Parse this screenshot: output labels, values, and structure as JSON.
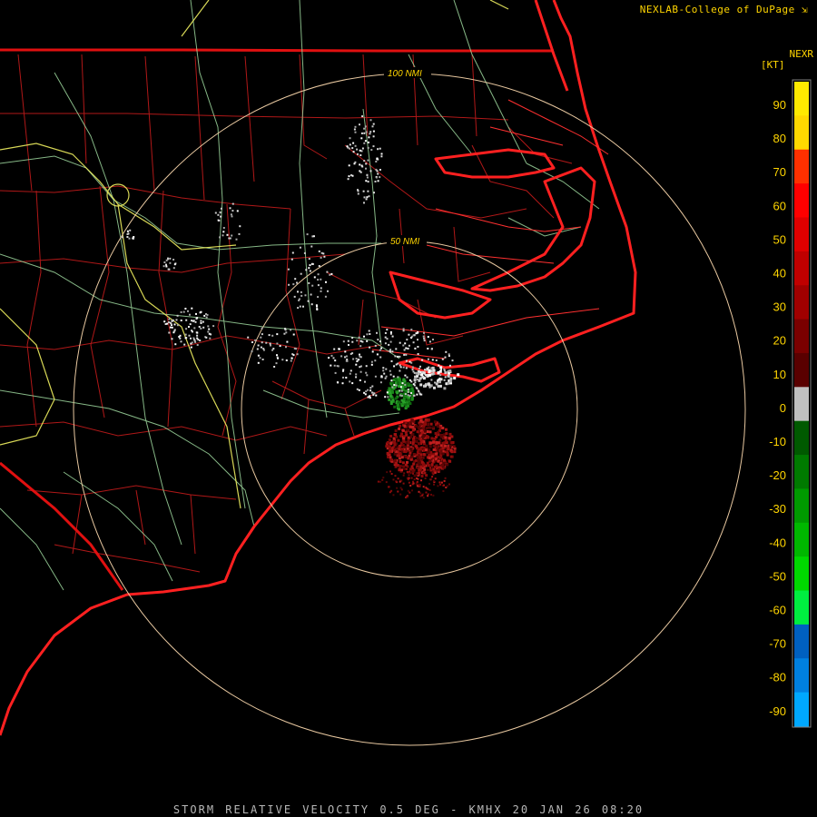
{
  "header": {
    "credit": "NEXLAB-College of DuPage"
  },
  "rings": [
    {
      "label": "50 NMI"
    },
    {
      "label": "100 NMI"
    }
  ],
  "legend": {
    "product": "NEXR",
    "unit": "[KT]",
    "ticks": [
      {
        "value": "90",
        "color": "#ffea00"
      },
      {
        "value": "80",
        "color": "#ffd800"
      },
      {
        "value": "70",
        "color": "#ff3000"
      },
      {
        "value": "60",
        "color": "#ff0000"
      },
      {
        "value": "50",
        "color": "#e00000"
      },
      {
        "value": "40",
        "color": "#c00000"
      },
      {
        "value": "30",
        "color": "#a00000"
      },
      {
        "value": "20",
        "color": "#7a0000"
      },
      {
        "value": "10",
        "color": "#5a0000"
      },
      {
        "value": "0",
        "color": "#c0c0c0"
      },
      {
        "value": "-10",
        "color": "#005a00"
      },
      {
        "value": "-20",
        "color": "#007a00"
      },
      {
        "value": "-30",
        "color": "#009a00"
      },
      {
        "value": "-40",
        "color": "#00b800"
      },
      {
        "value": "-50",
        "color": "#00d800"
      },
      {
        "value": "-60",
        "color": "#00ee40"
      },
      {
        "value": "-70",
        "color": "#0060c0"
      },
      {
        "value": "-80",
        "color": "#0080e0"
      },
      {
        "value": "-90",
        "color": "#00a8ff"
      }
    ]
  },
  "footer": {
    "caption": "STORM RELATIVE VELOCITY 0.5 DEG - KMHX 20 JAN 26 08:20"
  },
  "colors": {
    "coast": "#ff2020",
    "county": "#b01818",
    "highway_green": "#9ed89e",
    "highway_yellow": "#f0f060",
    "range_ring": "#e8c8a0",
    "label_yellow": "#ffd500",
    "outbound": "#8a0a0a",
    "inbound": "#1a8a1a",
    "near_zero": "#c8c8c8"
  }
}
